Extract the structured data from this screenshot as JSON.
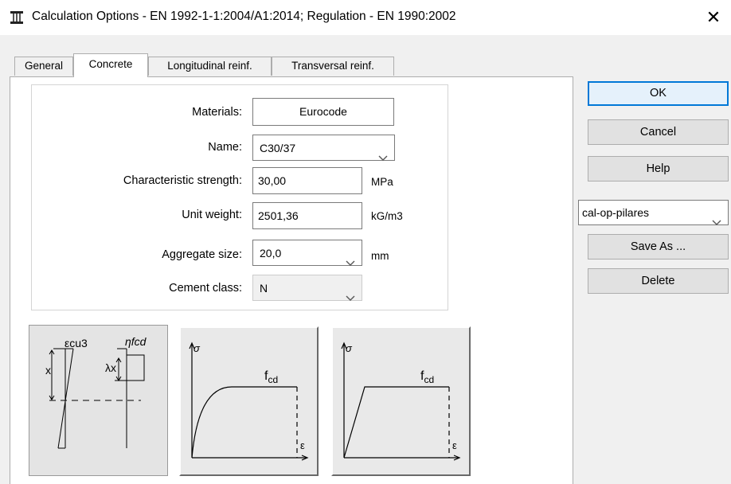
{
  "window": {
    "title": "Calculation Options - EN 1992-1-1:2004/A1:2014;  Regulation - EN 1990:2002",
    "close_glyph": "✕"
  },
  "tabs": [
    {
      "label": "General",
      "active": false
    },
    {
      "label": "Concrete",
      "active": true
    },
    {
      "label": "Longitudinal reinf.",
      "active": false
    },
    {
      "label": "Transversal reinf.",
      "active": false
    }
  ],
  "form": {
    "materials": {
      "label": "Materials:",
      "value": "Eurocode"
    },
    "name": {
      "label": "Name:",
      "value": "C30/37"
    },
    "characteristic_strength": {
      "label": "Characteristic strength:",
      "value": "30,00",
      "unit": "MPa"
    },
    "unit_weight": {
      "label": "Unit weight:",
      "value": "2501,36",
      "unit": "kG/m3"
    },
    "aggregate_size": {
      "label": "Aggregate size:",
      "value": "20,0",
      "unit": "mm"
    },
    "cement_class": {
      "label": "Cement class:",
      "value": "N",
      "disabled": true
    }
  },
  "diagrams": {
    "rect_block": {
      "label_ecu3": "εcu3",
      "label_eta_fcd": "ηfcd",
      "label_x": "x",
      "label_lambda_x": "λx",
      "selected": true
    },
    "parabola_rect": {
      "sigma": "σ",
      "fcd": "f",
      "fcd_sub": "cd",
      "eps": "ε"
    },
    "bilinear": {
      "sigma": "σ",
      "fcd": "f",
      "fcd_sub": "cd",
      "eps": "ε"
    }
  },
  "buttons": {
    "ok": "OK",
    "cancel": "Cancel",
    "help": "Help",
    "save_as": "Save As ...",
    "delete": "Delete"
  },
  "preset": {
    "value": "cal-op-pilares"
  },
  "colors": {
    "accent": "#0078d7",
    "button_face": "#e1e1e1",
    "dialog_bg": "#f0f0f0"
  }
}
